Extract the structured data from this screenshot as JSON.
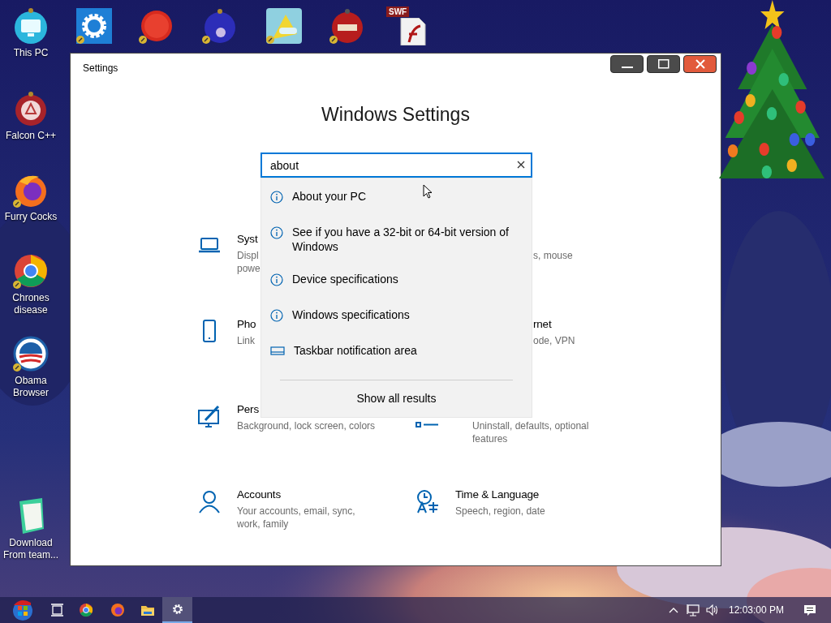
{
  "desktop_icons": [
    {
      "kind": "monitor",
      "label": "This PC"
    },
    {
      "kind": "gear"
    },
    {
      "kind": "fuzzball"
    },
    {
      "kind": "ornament_blue"
    },
    {
      "kind": "tile"
    },
    {
      "kind": "ornament_red"
    },
    {
      "kind": "flash",
      "badge": "SWF"
    },
    {
      "kind": "recycle",
      "label": "Falcon C++"
    },
    {
      "kind": "firefox",
      "label": "Furry Cocks"
    },
    {
      "kind": "chrome",
      "label": "Chrones disease"
    },
    {
      "kind": "stripes",
      "label": "Obama Browser"
    },
    {
      "kind": "notepad",
      "label": "Download From team..."
    }
  ],
  "window": {
    "title": "Settings",
    "heading": "Windows Settings",
    "search": {
      "value": "about"
    },
    "suggestions": [
      {
        "kind": "info",
        "text": "About your PC"
      },
      {
        "kind": "info",
        "text": "See if you have a 32-bit or 64-bit version of Windows"
      },
      {
        "kind": "info",
        "text": "Device specifications"
      },
      {
        "kind": "info",
        "text": "Windows specifications"
      },
      {
        "kind": "taskbar",
        "text": "Taskbar notification area"
      }
    ],
    "show_all": "Show all results",
    "categories": [
      {
        "kind": "laptop",
        "title": "Syst",
        "lines": [
          "Displ",
          "powe"
        ]
      },
      {
        "kind": "cut_left",
        "lines": [
          "s, mouse"
        ]
      },
      {
        "kind": "phone",
        "title": "Pho",
        "lines": [
          "Link"
        ]
      },
      {
        "kind": "cut_left",
        "title": "rnet",
        "lines": [
          "ode, VPN"
        ]
      },
      {
        "kind": "brush",
        "title": "Pers",
        "lines": [
          "Background, lock screen, colors"
        ]
      },
      {
        "kind": "apps_cut",
        "lines": [
          "Uninstall, defaults, optional",
          "features"
        ]
      },
      {
        "kind": "person",
        "title": "Accounts",
        "lines": [
          "Your accounts, email, sync,",
          "work, family"
        ]
      },
      {
        "kind": "clock_lang",
        "title": "Time & Language",
        "lines": [
          "Speech, region, date"
        ]
      }
    ]
  },
  "taskbar": {
    "apps": [
      {
        "kind": "start",
        "selected": false
      },
      {
        "kind": "taskview",
        "selected": false
      },
      {
        "kind": "chrome",
        "selected": false
      },
      {
        "kind": "firefox",
        "selected": false
      },
      {
        "kind": "folder",
        "selected": false
      },
      {
        "kind": "gear",
        "selected": true
      }
    ],
    "clock": "12:03:00 PM"
  }
}
